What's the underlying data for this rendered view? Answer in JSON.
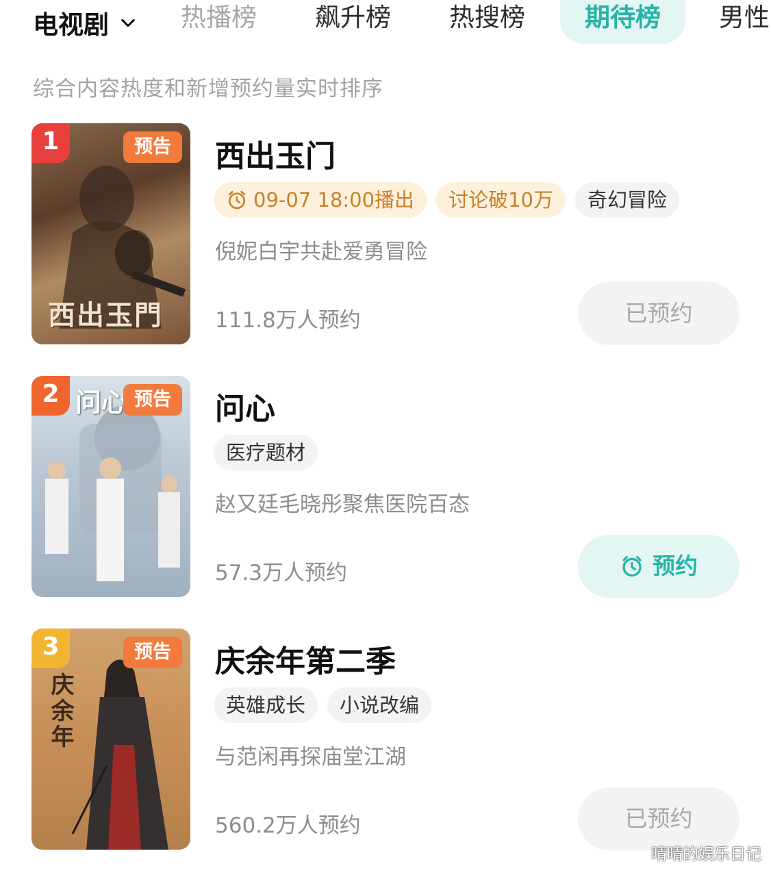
{
  "header": {
    "category": "电视剧",
    "tabs": [
      {
        "label": "热播榜"
      },
      {
        "label": "飙升榜"
      },
      {
        "label": "热搜榜"
      },
      {
        "label": "期待榜"
      },
      {
        "label": "男性"
      }
    ],
    "active_tab": "期待榜"
  },
  "subtitle": "综合内容热度和新增预约量实时排序",
  "items": [
    {
      "rank": "1",
      "badge": "预告",
      "poster_text": "西出玉門",
      "title": "西出玉门",
      "tags": [
        "09-07 18:00播出",
        "讨论破10万",
        "奇幻冒险"
      ],
      "desc": "倪妮白宇共赴爱勇冒险",
      "reserves": "111.8万人预约",
      "button": "已预约"
    },
    {
      "rank": "2",
      "badge": "预告",
      "poster_text": "问心",
      "title": "问心",
      "tags": [
        "医疗题材"
      ],
      "desc": "赵又廷毛晓彤聚焦医院百态",
      "reserves": "57.3万人预约",
      "button": "预约"
    },
    {
      "rank": "3",
      "badge": "预告",
      "poster_text": "庆余年",
      "title": "庆余年第二季",
      "tags": [
        "英雄成长",
        "小说改编"
      ],
      "desc": "与范闲再探庙堂江湖",
      "reserves": "560.2万人预约",
      "button": "已预约"
    }
  ],
  "colors": {
    "accent": "#26b4a6",
    "accent_bg": "#e4f6f3",
    "rank1": "#e8403c",
    "rank2": "#f0642e",
    "rank3": "#f2b531",
    "trailer_badge": "#f27a3c",
    "warm_tag_bg": "#fdf1dc",
    "warm_tag_text": "#c7812c"
  },
  "icons": {
    "chevron": "chevron-down-icon",
    "alarm": "alarm-clock-icon"
  },
  "watermark": "晴晴的娱乐日记"
}
